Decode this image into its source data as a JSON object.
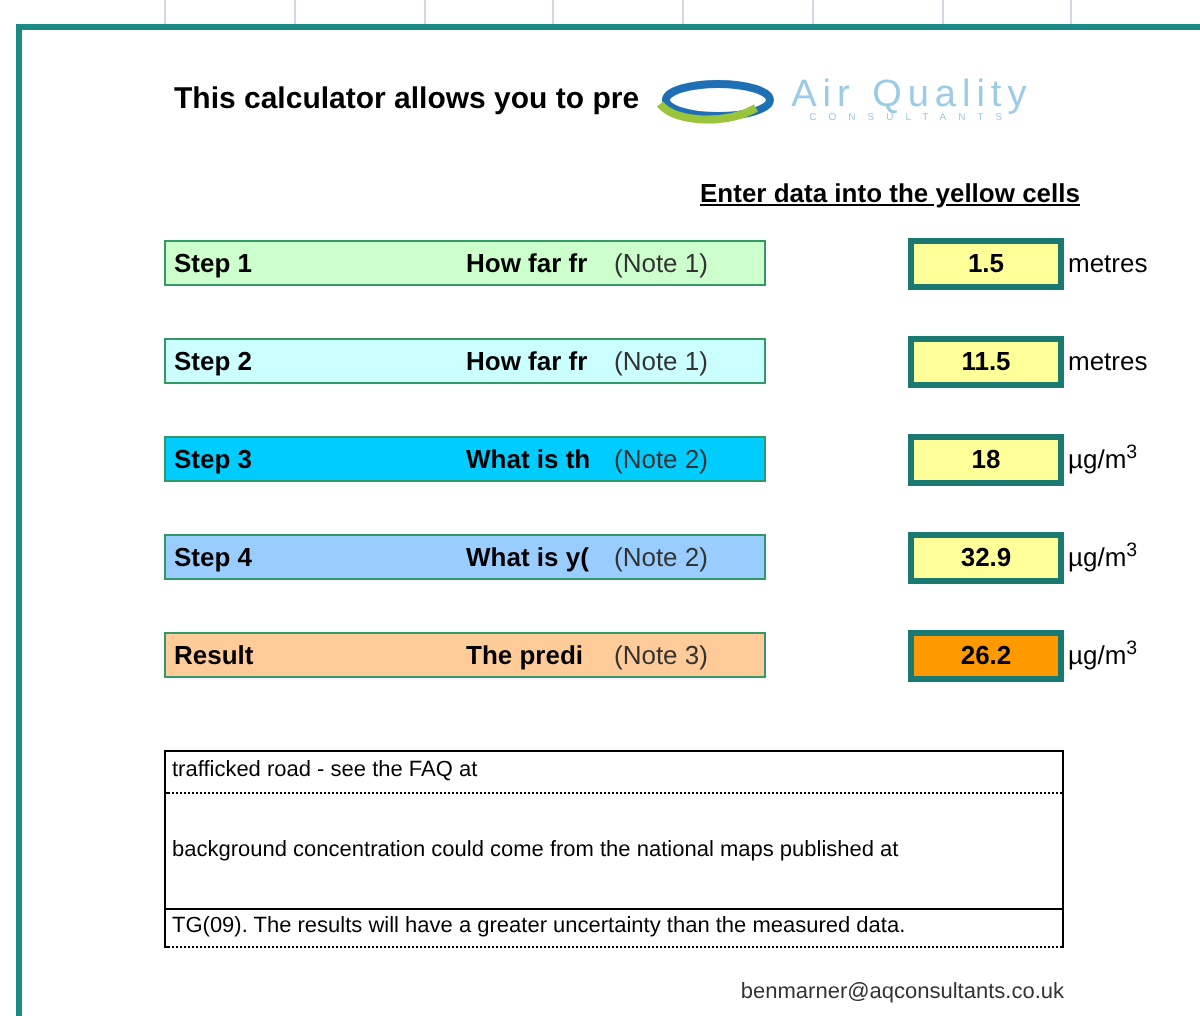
{
  "title": "This calculator allows you to pre",
  "logo": {
    "name": "Air Quality",
    "tagline": "CONSULTANTS"
  },
  "instruction": "Enter data into the yellow cells",
  "steps": [
    {
      "label": "Step 1",
      "question": "How far fr",
      "note": "(Note 1)",
      "color": "#ccffcc",
      "kind": "input",
      "value": "1.5",
      "unit": "metres"
    },
    {
      "label": "Step 2",
      "question": "How far fr",
      "note": "(Note 1)",
      "color": "#ccffff",
      "kind": "input",
      "value": "11.5",
      "unit": "metres"
    },
    {
      "label": "Step 3",
      "question": "What is th",
      "note": "(Note 2)",
      "color": "#00ccff",
      "kind": "input",
      "value": "18",
      "unit": "µg/m$^{3}$"
    },
    {
      "label": "Step 4",
      "question": "What is y(",
      "note": "(Note 2)",
      "color": "#99ccff",
      "kind": "input",
      "value": "32.9",
      "unit": "µg/m$^{3}$"
    },
    {
      "label": "Result",
      "question": "The predi",
      "note": "(Note 3)",
      "color": "#ffcc99",
      "kind": "result",
      "value": "26.2",
      "unit": "µg/m$^{3}$"
    }
  ],
  "notes": [
    "trafficked road - see the FAQ at",
    "background concentration could come from the national maps published at",
    "TG(09).  The results will have a greater uncertainty than the measured data."
  ],
  "contact": "benmarner@aqconsultants.co.uk"
}
